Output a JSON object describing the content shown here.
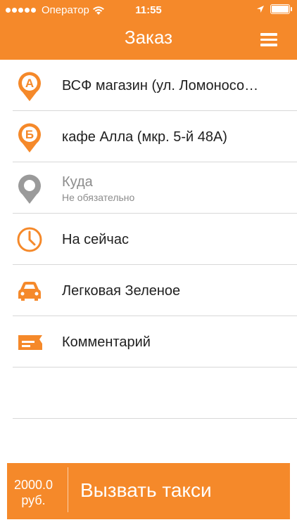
{
  "status_bar": {
    "carrier": "Оператор",
    "time": "11:55",
    "wifi_icon": "wifi-icon",
    "location_icon": "location-arrow-icon",
    "battery_icon": "battery-icon"
  },
  "nav": {
    "title": "Заказ",
    "menu_icon": "hamburger-menu-icon"
  },
  "colors": {
    "accent": "#f5892a",
    "text": "#1f1f1f",
    "muted": "#8c8c8c",
    "divider": "#d8d8d8"
  },
  "rows": [
    {
      "icon": "pin-a-icon",
      "label": "ВСФ магазин (ул. Ломоносо…"
    },
    {
      "icon": "pin-b-icon",
      "label": "кафе Алла (мкр. 5-й 48А)"
    },
    {
      "icon": "pin-gray-icon",
      "label": "Куда",
      "sublabel": "Не обязательно"
    },
    {
      "icon": "clock-icon",
      "label": "На сейчас"
    },
    {
      "icon": "car-icon",
      "label": "Легковая Зеленое"
    },
    {
      "icon": "comment-icon",
      "label": "Комментарий"
    }
  ],
  "pins": {
    "a_letter": "А",
    "b_letter": "Б"
  },
  "order": {
    "price_amount": "2000.0",
    "price_currency": "руб.",
    "button_label": "Вызвать такси"
  }
}
